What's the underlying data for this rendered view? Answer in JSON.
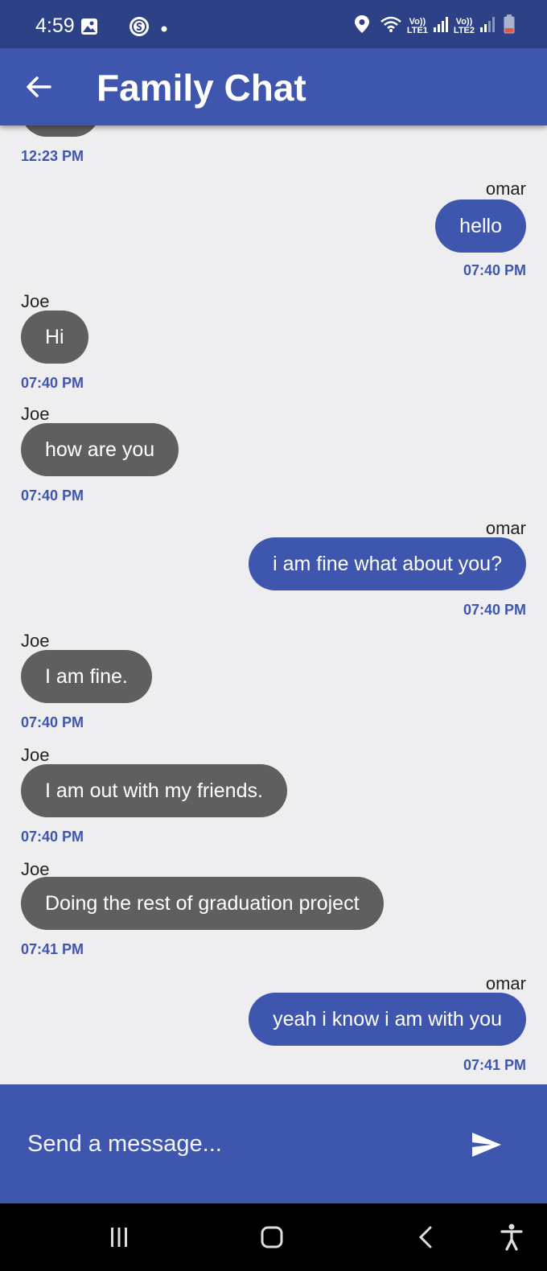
{
  "status_bar": {
    "time": "4:59",
    "sim1_label_top": "Vo))",
    "sim1_label_bottom": "LTE1",
    "sim2_label_top": "Vo))",
    "sim2_label_bottom": "LTE2"
  },
  "app_bar": {
    "title": "Family Chat",
    "back_icon": "arrow-left-icon"
  },
  "messages": [
    {
      "time": "12:23 PM"
    },
    {
      "direction": "out",
      "sender": "omar",
      "text": "hello",
      "time": "07:40 PM"
    },
    {
      "direction": "in",
      "sender": "Joe",
      "text": "Hi",
      "time": "07:40 PM"
    },
    {
      "direction": "in",
      "sender": "Joe",
      "text": "how are you",
      "time": "07:40 PM"
    },
    {
      "direction": "out",
      "sender": "omar",
      "text": "i am fine what about you?",
      "time": "07:40 PM"
    },
    {
      "direction": "in",
      "sender": "Joe",
      "text": "I am fine.",
      "time": "07:40 PM"
    },
    {
      "direction": "in",
      "sender": "Joe",
      "text": "I am out with my friends.",
      "time": "07:40 PM"
    },
    {
      "direction": "in",
      "sender": "Joe",
      "text": "Doing the rest of graduation project",
      "time": "07:41 PM"
    },
    {
      "direction": "out",
      "sender": "omar",
      "text": "yeah i know i am with you",
      "time": "07:41 PM"
    }
  ],
  "composer": {
    "placeholder": "Send a message...",
    "send_icon": "send-icon"
  },
  "colors": {
    "status_bar": "#2d4186",
    "primary": "#3f56ae",
    "incoming_bubble": "#5f5f5f",
    "background": "#eeedef"
  }
}
